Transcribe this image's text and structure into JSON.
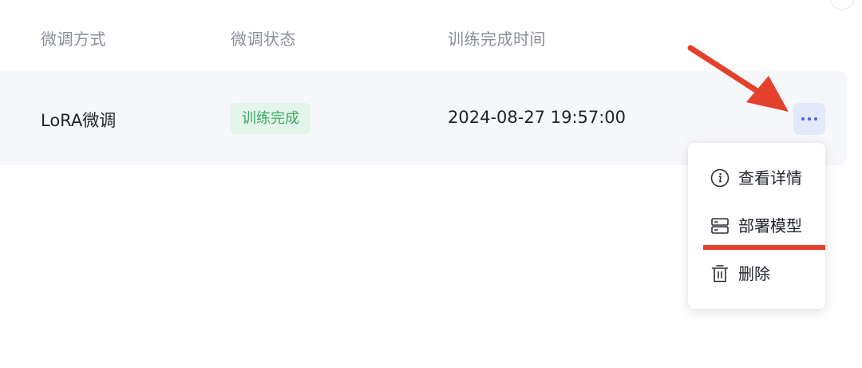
{
  "table": {
    "headers": {
      "method": "微调方式",
      "status": "微调状态",
      "finished_time": "训练完成时间"
    },
    "rows": [
      {
        "method": "LoRA微调",
        "status": "训练完成",
        "finished_time": "2024-08-27 19:57:00"
      }
    ]
  },
  "action_menu": {
    "trigger_icon": "more-horizontal-icon",
    "items": [
      {
        "icon": "info-icon",
        "label": "查看详情"
      },
      {
        "icon": "server-icon",
        "label": "部署模型"
      },
      {
        "icon": "trash-icon",
        "label": "删除"
      }
    ]
  },
  "colors": {
    "status_badge_bg": "#e3f4ea",
    "status_badge_text": "#3daa65",
    "more_button_bg": "#e4e8fb",
    "more_button_dots": "#4a64e8",
    "annotation": "#e4412c"
  }
}
